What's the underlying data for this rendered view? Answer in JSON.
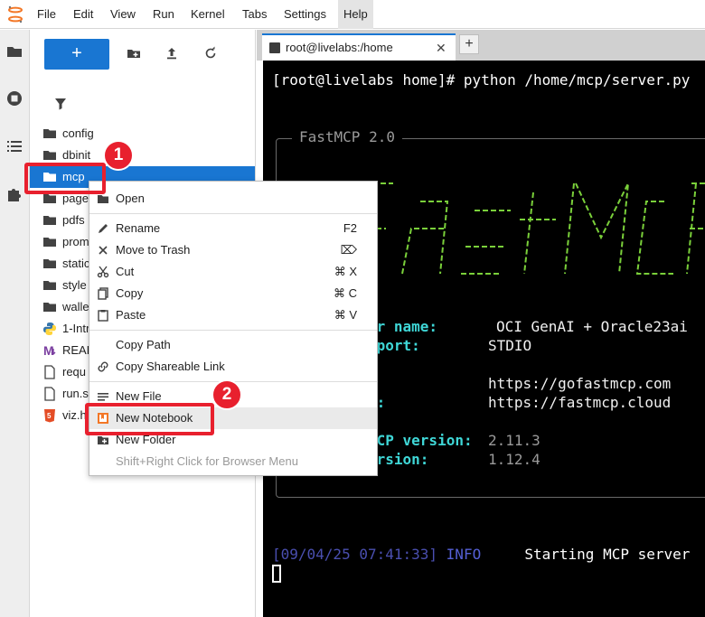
{
  "menubar": {
    "items": [
      "File",
      "Edit",
      "View",
      "Run",
      "Kernel",
      "Tabs",
      "Settings",
      "Help"
    ]
  },
  "activity": {
    "icons": [
      "folder-icon",
      "running-icon",
      "toc-icon",
      "extension-icon"
    ]
  },
  "filebrowser": {
    "new_launcher_label": "+",
    "toolbar_icons": [
      "new-folder-icon",
      "upload-icon",
      "refresh-icon"
    ],
    "items": [
      {
        "name": "config",
        "icon": "folder-icon"
      },
      {
        "name": "dbinit",
        "icon": "folder-icon"
      },
      {
        "name": "mcp",
        "icon": "folder-icon",
        "selected": true
      },
      {
        "name": "page",
        "icon": "folder-icon"
      },
      {
        "name": "pdfs",
        "icon": "folder-icon"
      },
      {
        "name": "prom",
        "icon": "folder-icon"
      },
      {
        "name": "static",
        "icon": "folder-icon"
      },
      {
        "name": "style",
        "icon": "folder-icon"
      },
      {
        "name": "walle",
        "icon": "folder-icon"
      },
      {
        "name": "1-Intr",
        "icon": "python-file-icon"
      },
      {
        "name": "READ",
        "icon": "markdown-icon"
      },
      {
        "name": "requ",
        "icon": "text-file-icon"
      },
      {
        "name": "run.s",
        "icon": "text-file-icon"
      },
      {
        "name": "viz.h",
        "icon": "html-file-icon"
      }
    ]
  },
  "tabs": {
    "terminal_tab_label": "root@livelabs:/home",
    "close_glyph": "✕",
    "add_glyph": "+"
  },
  "terminal": {
    "prompt_line": "[root@livelabs home]# python /home/mcp/server.py",
    "box_title": "FastMCP 2.0",
    "rows": [
      {
        "label": "er name:",
        "value": "OCI GenAI + Oracle23ai"
      },
      {
        "label": "sport:",
        "value": "STDIO"
      },
      {
        "label": "",
        "value": "https://gofastmcp.com"
      },
      {
        "label": "y:",
        "value": "https://fastmcp.cloud"
      },
      {
        "label": "MCP version:",
        "value": "2.11.3"
      },
      {
        "label": "ersion:",
        "value": "1.12.4"
      }
    ],
    "log_timestamp": "[09/04/25 07:41:33]",
    "log_level": "INFO",
    "log_message": "Starting MCP server"
  },
  "context_menu": {
    "items": [
      {
        "label": "Open",
        "icon": "folder-icon",
        "shortcut": ""
      },
      {
        "label": "Rename",
        "icon": "pencil-icon",
        "shortcut": "F2"
      },
      {
        "label": "Move to Trash",
        "icon": "close-icon",
        "shortcut": "⌦"
      },
      {
        "label": "Cut",
        "icon": "scissors-icon",
        "shortcut": "⌘ X"
      },
      {
        "label": "Copy",
        "icon": "copy-icon",
        "shortcut": "⌘ C"
      },
      {
        "label": "Paste",
        "icon": "paste-icon",
        "shortcut": "⌘ V"
      },
      {
        "label": "Copy Path",
        "icon": "",
        "shortcut": ""
      },
      {
        "label": "Copy Shareable Link",
        "icon": "link-icon",
        "shortcut": ""
      },
      {
        "label": "New File",
        "icon": "new-file-icon",
        "shortcut": ""
      },
      {
        "label": "New Notebook",
        "icon": "notebook-icon",
        "shortcut": ""
      },
      {
        "label": "New Folder",
        "icon": "new-folder-icon",
        "shortcut": ""
      },
      {
        "label": "Shift+Right Click for Browser Menu",
        "icon": "",
        "shortcut": ""
      }
    ]
  },
  "annotations": {
    "step1": "1",
    "step2": "2"
  },
  "colors": {
    "accent": "#1976d2",
    "annotation": "#e8202e",
    "terminal_label": "#3fd7d7",
    "terminal_ascii": "#7ad03a"
  }
}
